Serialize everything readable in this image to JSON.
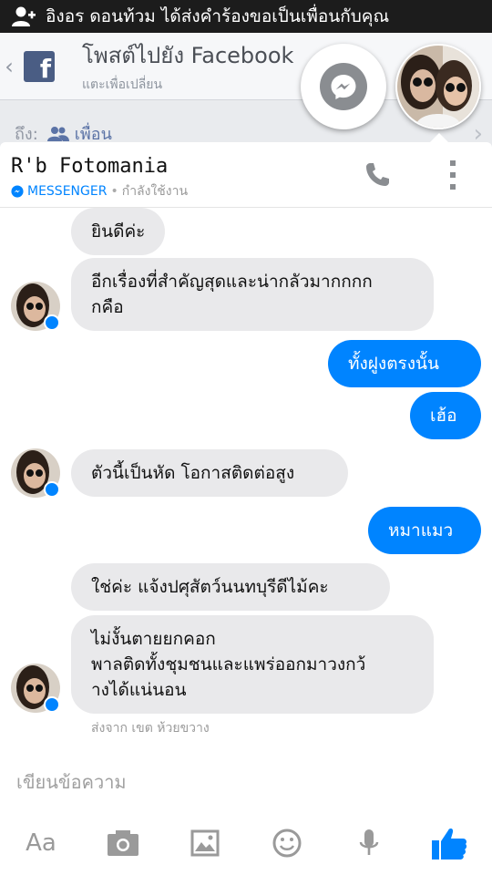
{
  "statusbar": {
    "notification_text": "อิงอร ดอนท้วม ได้ส่งคำร้องขอเป็นเพื่อนกับคุณ",
    "icon": "add-friend-icon"
  },
  "background_dialog": {
    "title": "โพสต์ไปยัง Facebook",
    "subtitle": "แตะเพื่อเปลี่ยน",
    "to_label": "ถึง:",
    "audience": "เพื่อน",
    "logo_letter": "f"
  },
  "chat": {
    "name": "R'b Fotomania",
    "platform": "MESSENGER",
    "separator": "•",
    "status": "กำลังใช้งาน",
    "accent_color": "#0084ff"
  },
  "messages": [
    {
      "side": "in",
      "text": "ยินดีค่ะ"
    },
    {
      "side": "in",
      "text": "อีกเรื่องที่สำคัญสุดและน่ากลัวมากกกก\nกคือ"
    },
    {
      "side": "out",
      "text": "ทั้งฝูงตรงนั้น"
    },
    {
      "side": "out",
      "text": "เฮ้อ"
    },
    {
      "side": "in",
      "text": "ตัวนี้เป็นหัด โอกาสติดต่อสูง"
    },
    {
      "side": "out",
      "text": "หมาแมว"
    },
    {
      "side": "in",
      "text": "ใช่ค่ะ แจ้งปศุสัตว์นนทบุรีดีไม้คะ"
    },
    {
      "side": "in",
      "text": "ไม่งั้นตายยกคอก\nพาลติดทั้งชุมชนและแพร่ออกมาวงกว้\nางได้แน่นอน"
    }
  ],
  "sent_from": "ส่งจาก เขต ห้วยขวาง",
  "composer": {
    "placeholder": "เขียนข้อความ"
  },
  "toolbar": {
    "aa_label": "Aa",
    "icons": [
      "camera-icon",
      "image-icon",
      "emoji-icon",
      "microphone-icon",
      "like-icon"
    ]
  }
}
